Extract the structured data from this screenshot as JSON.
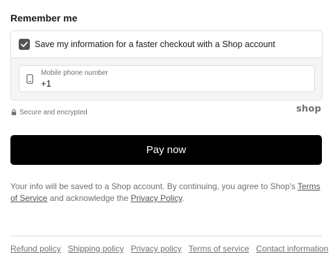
{
  "remember": {
    "title": "Remember me",
    "checkbox_label": "Save my information for a faster checkout with a Shop account",
    "checked": true
  },
  "phone": {
    "label": "Mobile phone number",
    "value": "+1",
    "icon": "mobile-phone-icon"
  },
  "security": {
    "text": "Secure and encrypted",
    "icon": "lock-icon"
  },
  "brand": {
    "logo_text": "shop"
  },
  "pay": {
    "label": "Pay now"
  },
  "info": {
    "prefix": "Your info will be saved to a Shop account. By continuing, you agree to Shop's ",
    "terms_link": "Terms of Service",
    "middle": " and acknowledge the ",
    "privacy_link": "Privacy Policy",
    "suffix": "."
  },
  "footer": {
    "links": [
      "Refund policy",
      "Shipping policy",
      "Privacy policy",
      "Terms of service",
      "Contact information"
    ]
  },
  "colors": {
    "button_bg": "#000000",
    "checkbox_bg": "#545454",
    "muted_text": "#707070",
    "border": "#dedede"
  }
}
